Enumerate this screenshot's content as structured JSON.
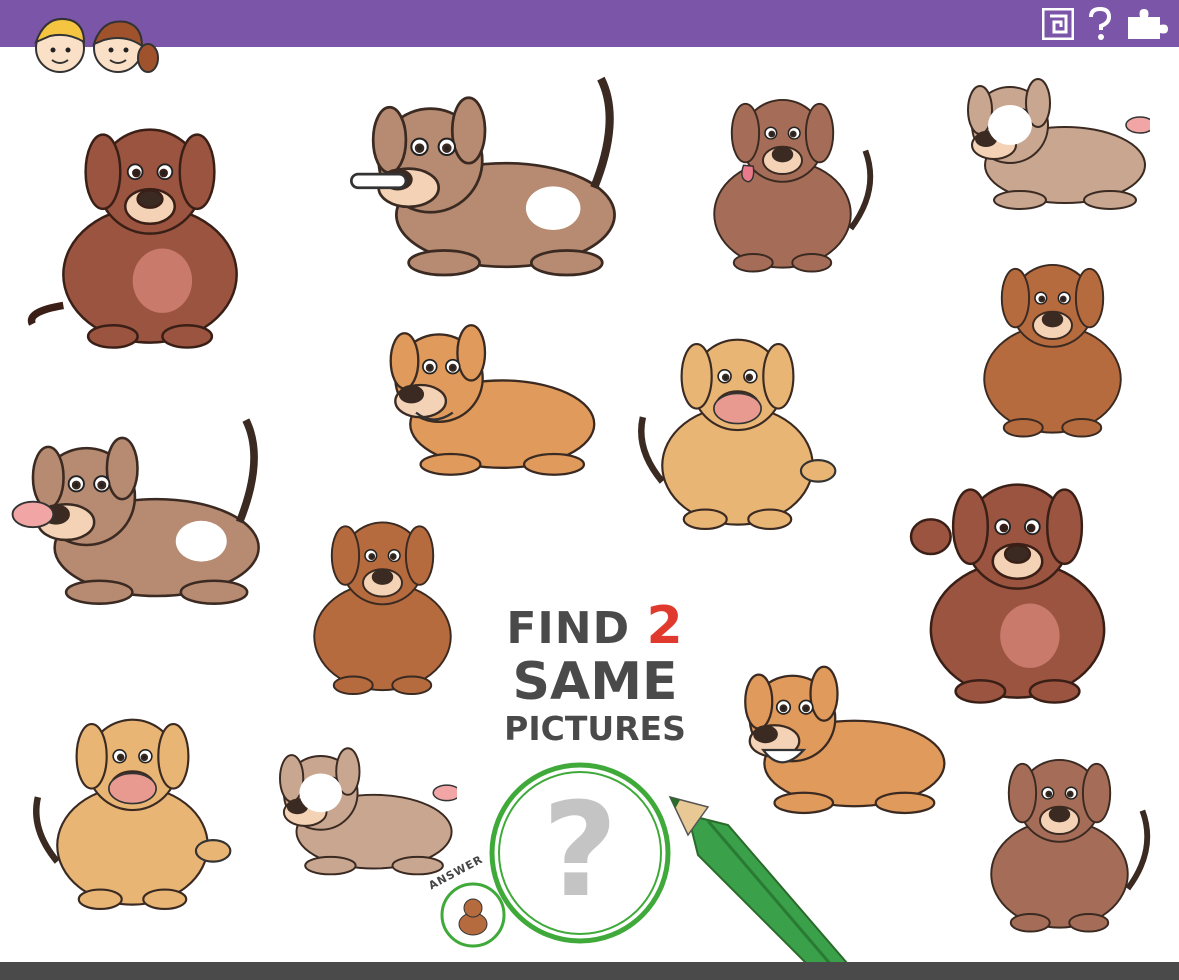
{
  "heading": {
    "line1": "FIND",
    "number": "2",
    "line2": "SAME",
    "line3": "PICTURES"
  },
  "answer_label": "ANSWER",
  "placeholder_glyph": "?",
  "top_icons": [
    "maze-icon",
    "question-icon",
    "puzzle-icon"
  ],
  "colors": {
    "topbar": "#7a55a8",
    "title_text": "#4a4a4a",
    "title_number": "#e03a2f",
    "magnifier_ring": "#3fa93a",
    "pencil": "#3aa04a"
  },
  "dogs": [
    {
      "id": "dog-1",
      "type": "big-brown-sitting"
    },
    {
      "id": "dog-2",
      "type": "spotted-bone-playing"
    },
    {
      "id": "dog-3",
      "type": "brown-tongue-sitting"
    },
    {
      "id": "dog-4",
      "type": "puppy-light-standing"
    },
    {
      "id": "dog-5",
      "type": "orange-lying"
    },
    {
      "id": "dog-6",
      "type": "tan-paw-raised"
    },
    {
      "id": "dog-7",
      "type": "brown-floppy-sitting"
    },
    {
      "id": "dog-8",
      "type": "spotted-playing"
    },
    {
      "id": "dog-9",
      "type": "brown-floppy-sitting"
    },
    {
      "id": "dog-10",
      "type": "big-brown-waving"
    },
    {
      "id": "dog-11",
      "type": "orange-lying-smiling"
    },
    {
      "id": "dog-12",
      "type": "tan-paw-raised"
    },
    {
      "id": "dog-13",
      "type": "puppy-light-standing"
    },
    {
      "id": "dog-14",
      "type": "brown-sitting"
    }
  ]
}
